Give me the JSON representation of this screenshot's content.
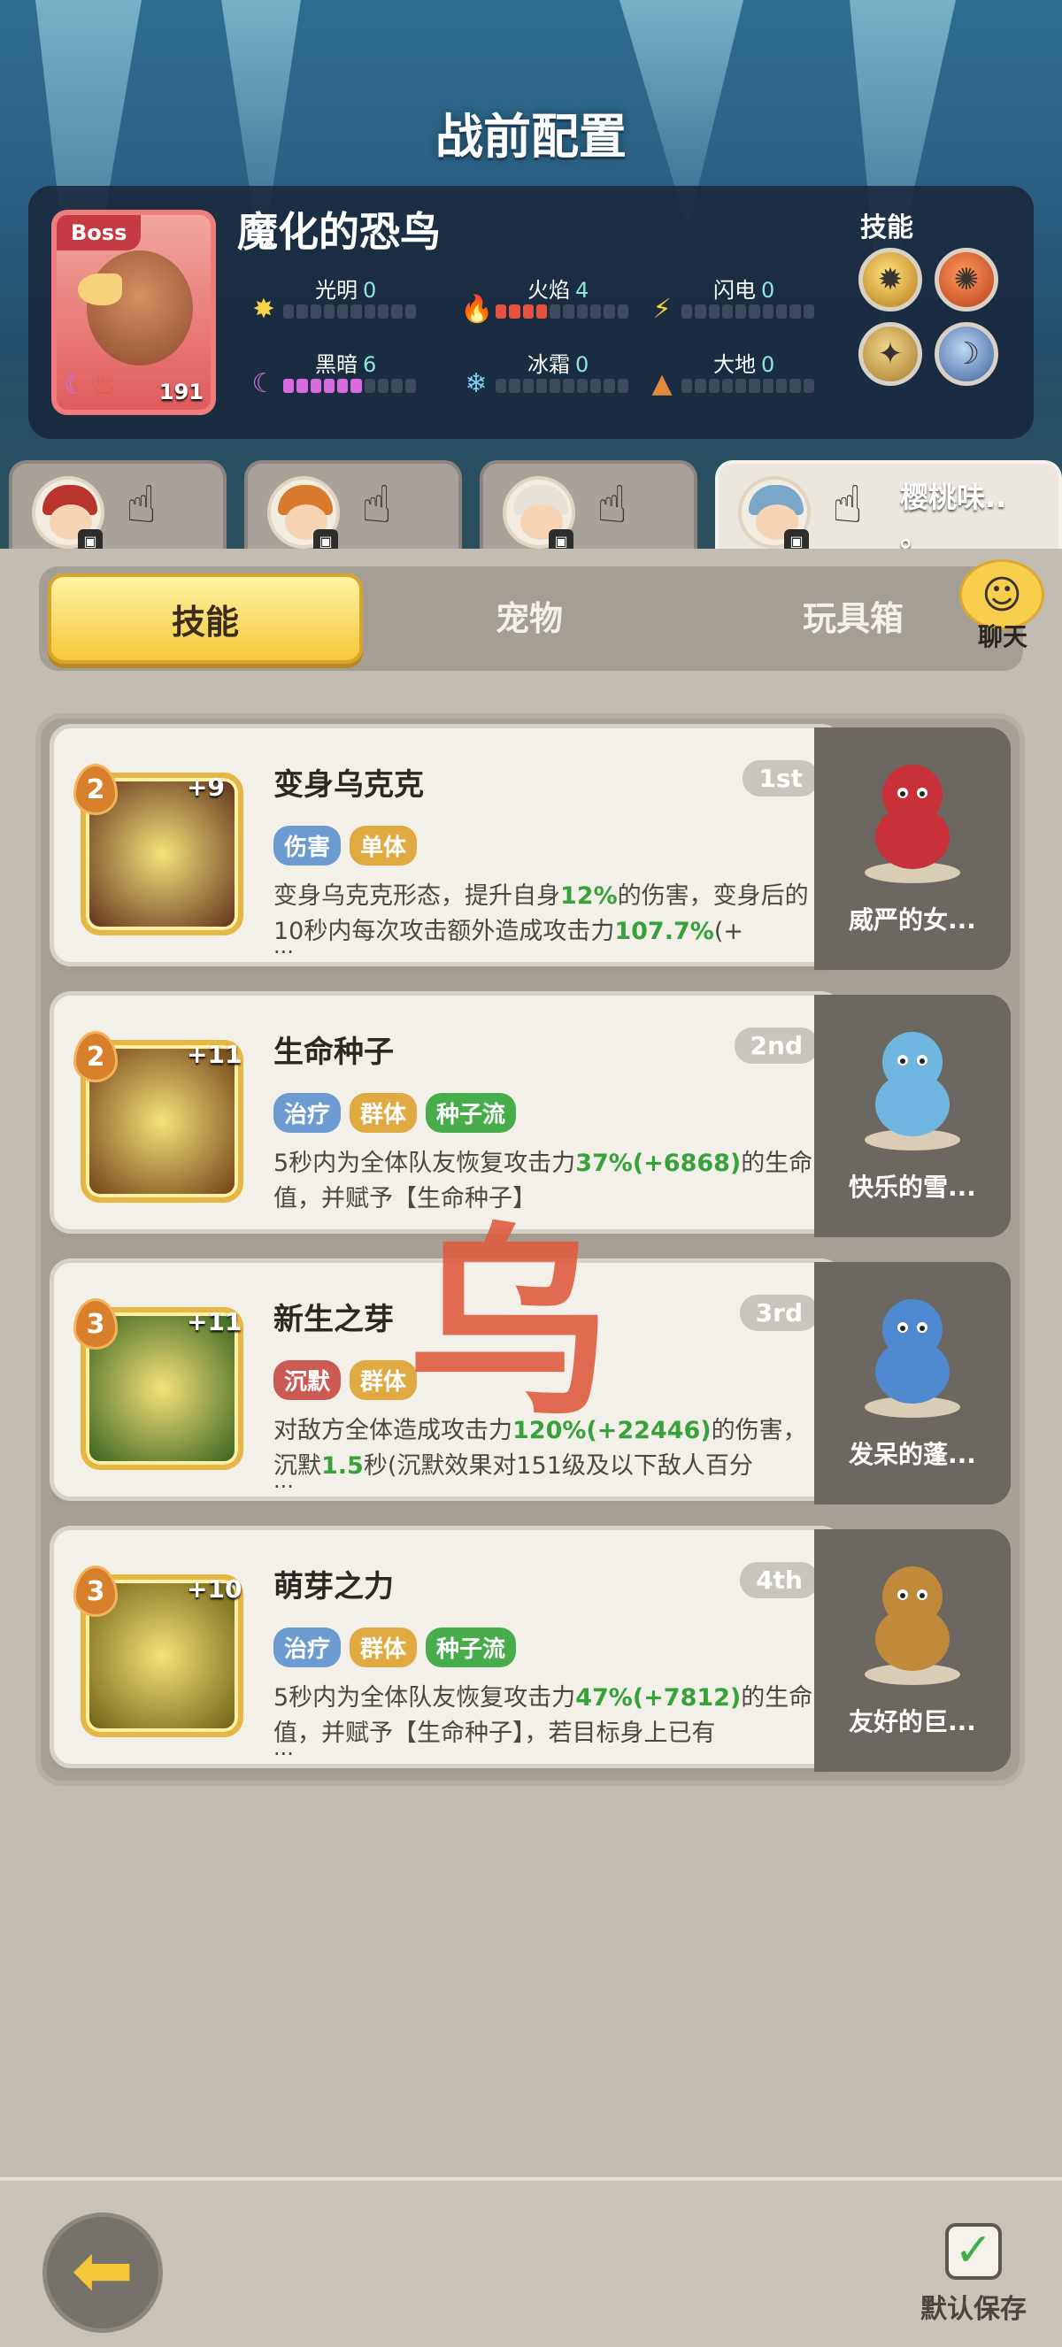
{
  "header": {
    "title": "战前配置"
  },
  "boss": {
    "tag": "Boss",
    "name": "魔化的恐鸟",
    "level": "191",
    "elements": [
      {
        "name": "光明",
        "value": "0",
        "filled": 0,
        "color": "#f6d54b",
        "icon": "sun-icon"
      },
      {
        "name": "火焰",
        "value": "4",
        "filled": 4,
        "color": "#e4533d",
        "icon": "flame-icon"
      },
      {
        "name": "闪电",
        "value": "0",
        "filled": 0,
        "color": "#f7cf2f",
        "icon": "lightning-icon"
      },
      {
        "name": "黑暗",
        "value": "6",
        "filled": 6,
        "color": "#d86adf",
        "icon": "moon-icon"
      },
      {
        "name": "冰霜",
        "value": "0",
        "filled": 0,
        "color": "#7fd0f2",
        "icon": "snowflake-icon"
      },
      {
        "name": "大地",
        "value": "0",
        "filled": 0,
        "color": "#e08a3d",
        "icon": "mountain-icon"
      }
    ],
    "skills_label": "技能"
  },
  "team_tabs": [
    {
      "hair_color": "#b9342b",
      "name": ""
    },
    {
      "hair_color": "#d77a2e",
      "name": ""
    },
    {
      "hair_color": "#e8e1d7",
      "name": ""
    },
    {
      "hair_color": "#7aa6c9",
      "name": "樱桃味..\n。"
    }
  ],
  "tabs": {
    "skills": "技能",
    "pets": "宠物",
    "toybox": "玩具箱"
  },
  "chat": {
    "label": "聊天"
  },
  "skills": [
    {
      "level": "2",
      "plus": "+9",
      "name": "变身乌克克",
      "rank": "1st",
      "tags": [
        {
          "text": "伤害",
          "color": "blue"
        },
        {
          "text": "单体",
          "color": "orange"
        }
      ],
      "desc_parts": [
        "变身乌克克形态，提升自身",
        "12%",
        "的伤害，变身后的10秒内每次攻击额外造成攻击力",
        "107.7%",
        "(+"
      ],
      "more": "...",
      "icon_bg": "#5a2a18",
      "pet": {
        "name": "威严的女...",
        "color": "#c8303a"
      }
    },
    {
      "level": "2",
      "plus": "+11",
      "name": "生命种子",
      "rank": "2nd",
      "tags": [
        {
          "text": "治疗",
          "color": "blue"
        },
        {
          "text": "群体",
          "color": "orange"
        },
        {
          "text": "种子流",
          "color": "green"
        }
      ],
      "desc_parts": [
        "5秒内为全体队友恢复攻击力",
        "37%(+6868)",
        "的生命值，并赋予【生命种子】",
        "",
        ""
      ],
      "more": "",
      "icon_bg": "#6b3a12",
      "pet": {
        "name": "快乐的雪...",
        "color": "#6fb7e0"
      }
    },
    {
      "level": "3",
      "plus": "+11",
      "name": "新生之芽",
      "rank": "3rd",
      "tags": [
        {
          "text": "沉默",
          "color": "red"
        },
        {
          "text": "群体",
          "color": "orange"
        }
      ],
      "desc_parts": [
        "对敌方全体造成攻击力",
        "120%(+22446)",
        "的伤害，沉默",
        "1.5",
        "秒(沉默效果对151级及以下敌人百分"
      ],
      "more": "...",
      "icon_bg": "#2f5d1a",
      "pet": {
        "name": "发呆的蓬...",
        "color": "#4f8ad0"
      }
    },
    {
      "level": "3",
      "plus": "+10",
      "name": "萌芽之力",
      "rank": "4th",
      "tags": [
        {
          "text": "治疗",
          "color": "blue"
        },
        {
          "text": "群体",
          "color": "orange"
        },
        {
          "text": "种子流",
          "color": "green"
        }
      ],
      "desc_parts": [
        "5秒内为全体队友恢复攻击力",
        "47%(+7812)",
        "的生命值，并赋予【生命种子】，若目标身上已有",
        "",
        ""
      ],
      "more": "...",
      "icon_bg": "#6a5a10",
      "pet": {
        "name": "友好的巨...",
        "color": "#c08a3a"
      }
    }
  ],
  "watermark": "乌",
  "footer": {
    "save_label": "默认保存"
  }
}
